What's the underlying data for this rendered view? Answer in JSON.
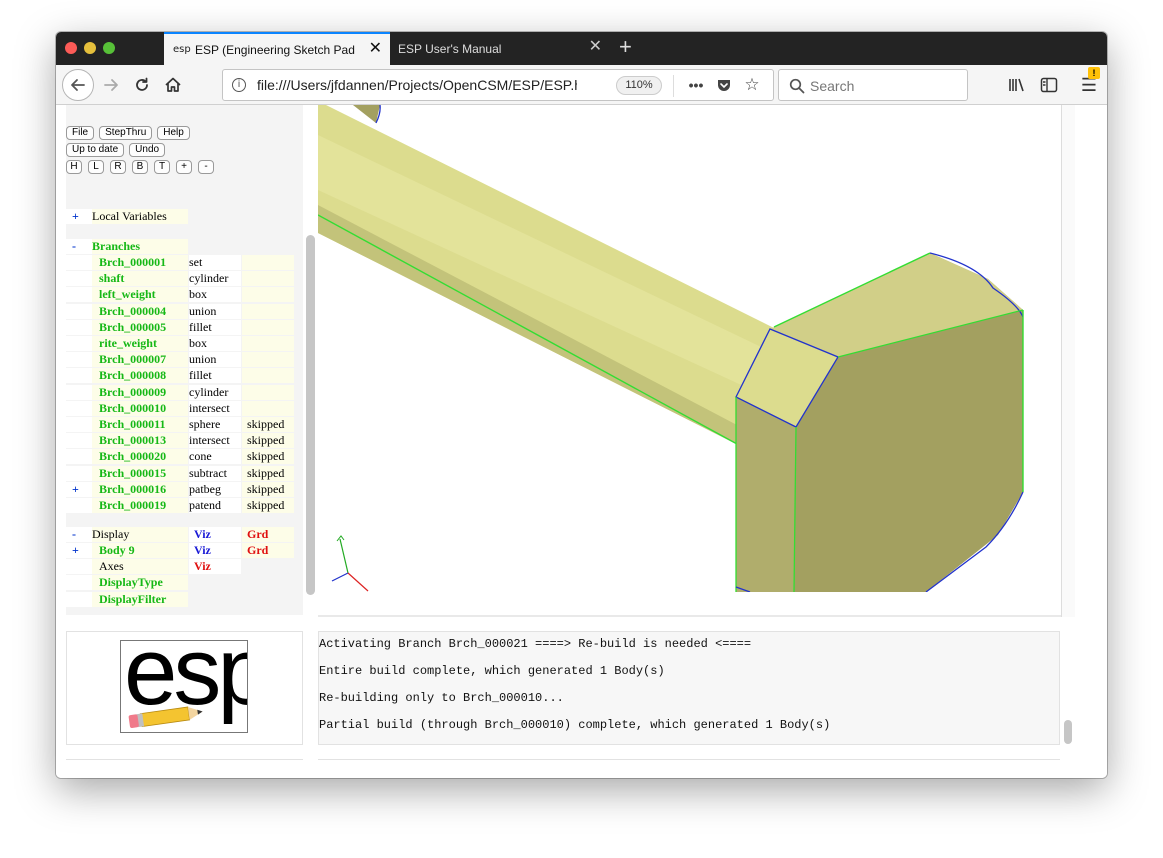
{
  "browser": {
    "tabs": [
      {
        "favicon": "esp",
        "title": "ESP (Engineering Sketch Pad, V",
        "active": true
      },
      {
        "title": "ESP User's Manual",
        "active": false
      }
    ],
    "new_tab": "+",
    "url": "file:///Users/jfdannen/Projects/OpenCSM/ESP/ESP.h",
    "zoom": "110%",
    "search_placeholder": "Search"
  },
  "toolbar": {
    "row1": [
      "File",
      "StepThru",
      "Help"
    ],
    "row2": [
      "Up to date",
      "Undo"
    ],
    "row3": [
      "H",
      "L",
      "R",
      "B",
      "T",
      "+",
      "-"
    ]
  },
  "tree": {
    "local_variables": {
      "toggle": "+",
      "label": "Local Variables"
    },
    "branches_header": {
      "toggle": "-",
      "label": "Branches"
    },
    "branches": [
      {
        "toggle": "",
        "name": "Brch_000001",
        "type": "set",
        "status": ""
      },
      {
        "toggle": "",
        "name": "shaft",
        "type": "cylinder",
        "status": ""
      },
      {
        "toggle": "",
        "name": "left_weight",
        "type": "box",
        "status": ""
      },
      {
        "toggle": "",
        "name": "Brch_000004",
        "type": "union",
        "status": ""
      },
      {
        "toggle": "",
        "name": "Brch_000005",
        "type": "fillet",
        "status": ""
      },
      {
        "toggle": "",
        "name": "rite_weight",
        "type": "box",
        "status": ""
      },
      {
        "toggle": "",
        "name": "Brch_000007",
        "type": "union",
        "status": ""
      },
      {
        "toggle": "",
        "name": "Brch_000008",
        "type": "fillet",
        "status": ""
      },
      {
        "toggle": "",
        "name": "Brch_000009",
        "type": "cylinder",
        "status": ""
      },
      {
        "toggle": "",
        "name": "Brch_000010",
        "type": "intersect",
        "status": ""
      },
      {
        "toggle": "",
        "name": "Brch_000011",
        "type": "sphere",
        "status": "skipped"
      },
      {
        "toggle": "",
        "name": "Brch_000013",
        "type": "intersect",
        "status": "skipped"
      },
      {
        "toggle": "",
        "name": "Brch_000020",
        "type": "cone",
        "status": "skipped"
      },
      {
        "toggle": "",
        "name": "Brch_000015",
        "type": "subtract",
        "status": "skipped"
      },
      {
        "toggle": "+",
        "name": "Brch_000016",
        "type": "patbeg",
        "status": "skipped"
      },
      {
        "toggle": "",
        "name": "Brch_000019",
        "type": "patend",
        "status": "skipped"
      }
    ],
    "display": {
      "toggle": "-",
      "label": "Display",
      "viz": "Viz",
      "grd": "Grd"
    },
    "body": {
      "toggle": "+",
      "label": "Body 9",
      "viz": "Viz",
      "grd": "Grd"
    },
    "axes": {
      "label": "Axes",
      "viz": "Viz"
    },
    "display_type": "DisplayType",
    "display_filter": "DisplayFilter"
  },
  "logo": {
    "text": "esp"
  },
  "messages": [
    "Activating Branch Brch_000021 ====> Re-build is needed <====",
    "Entire build complete, which generated 1 Body(s)",
    "Re-building only to Brch_000010...",
    "Partial build (through Brch_000010) complete, which generated 1 Body(s)"
  ],
  "colors": {
    "branch_green": "#16b816",
    "viz_blue": "#1a1ad6",
    "grd_red": "#e01010",
    "model_face": "#dcdc8e",
    "model_side": "#a3a060",
    "edge_green": "#33dd33",
    "edge_blue": "#2233cc"
  },
  "icons": [
    "back-arrow-icon",
    "forward-arrow-icon",
    "reload-icon",
    "home-icon",
    "info-icon",
    "page-actions-icon",
    "pocket-icon",
    "bookmark-star-icon",
    "search-icon",
    "library-icon",
    "sidebar-icon",
    "hamburger-menu-icon",
    "warning-icon"
  ]
}
